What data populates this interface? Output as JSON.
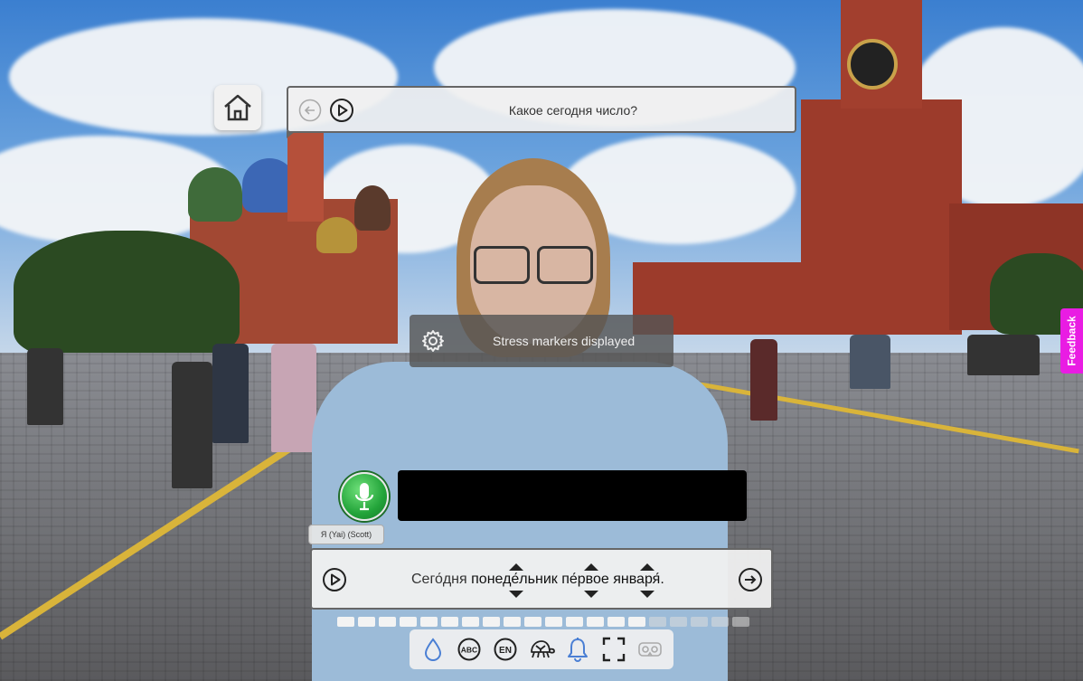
{
  "prompt": {
    "question": "Какое сегодня число?"
  },
  "settings_toast": {
    "message": "Stress markers displayed"
  },
  "speaker": {
    "label": "Я (Yai) (Scott)"
  },
  "answer": {
    "words": [
      "Сего́дня",
      "понеде́льник",
      "пе́рвое",
      "января́."
    ]
  },
  "progress": {
    "filled_segments": 15,
    "total_segments": 20
  },
  "toolbar": {
    "icons": [
      "drop-icon",
      "abc-icon",
      "en-icon",
      "turtle-icon",
      "bell-icon",
      "fullscreen-icon",
      "vr-headset-icon"
    ]
  },
  "feedback": {
    "label": "Feedback"
  },
  "colors": {
    "mic_green": "#23a43a",
    "accent_blue": "#4a7fd4",
    "feedback_pink": "#e91ce3"
  }
}
